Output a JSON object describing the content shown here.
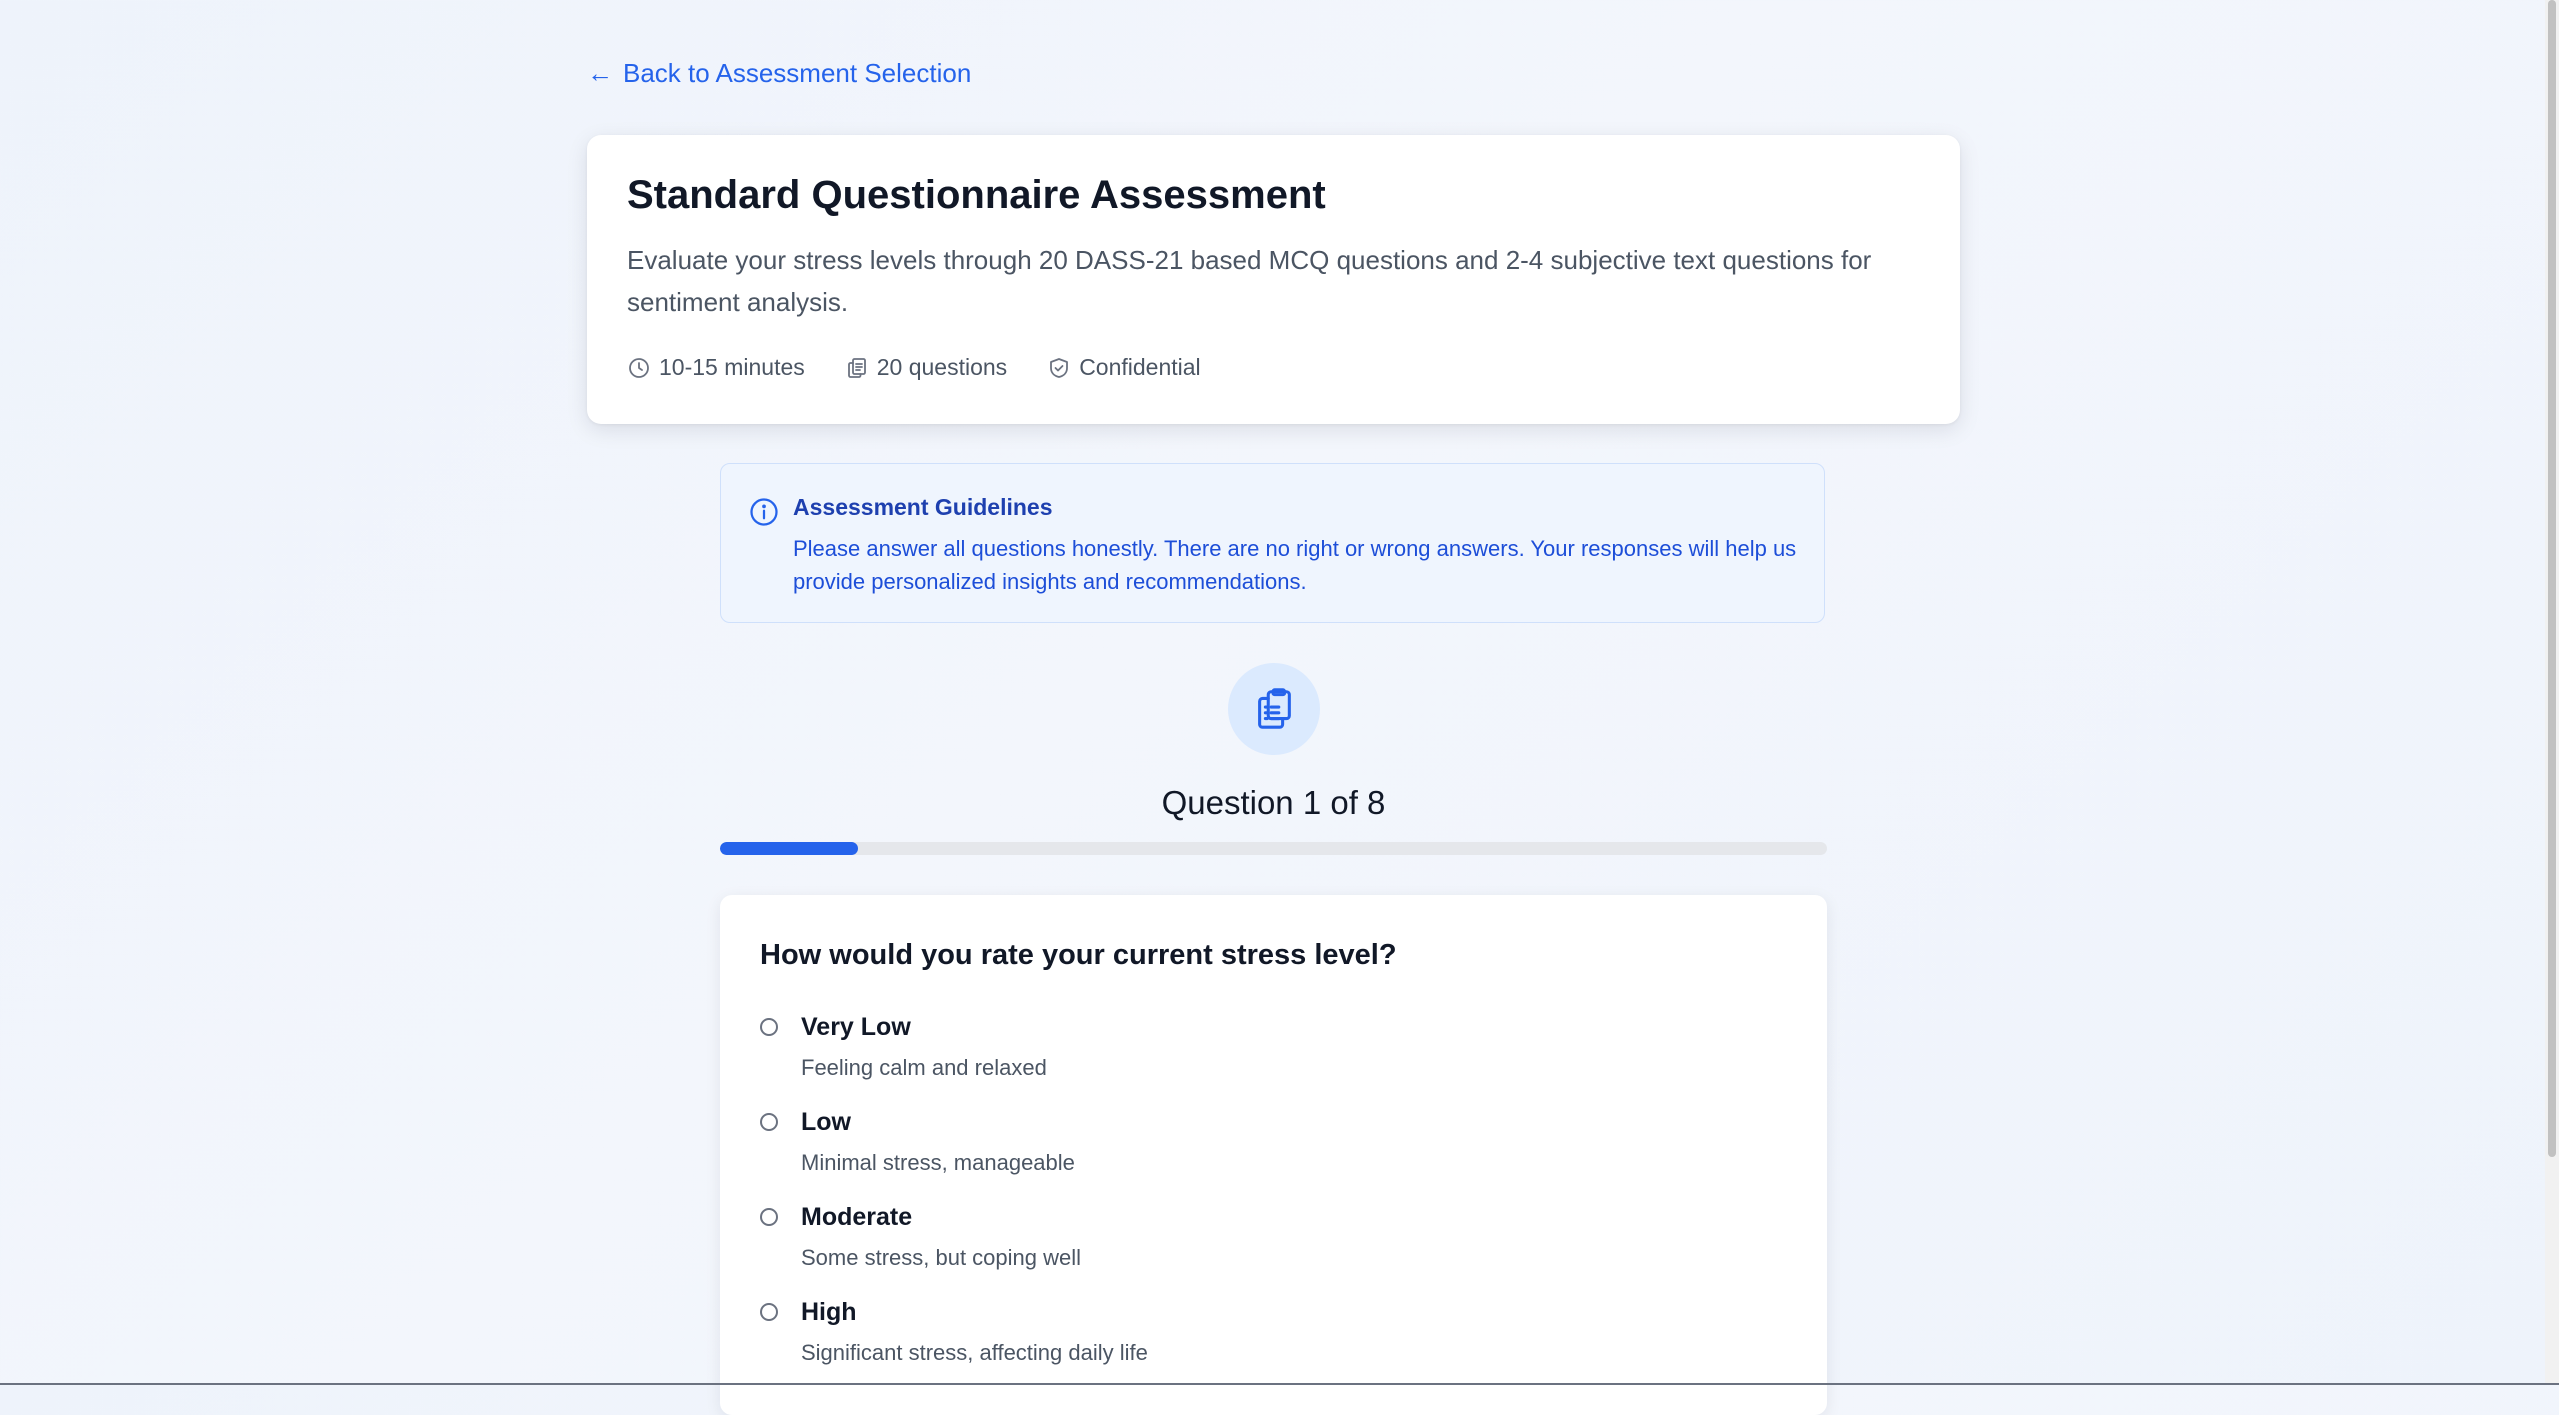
{
  "nav": {
    "back_arrow": "←",
    "back_label": "Back to Assessment Selection"
  },
  "header": {
    "title": "Standard Questionnaire Assessment",
    "description": "Evaluate your stress levels through 20 DASS-21 based MCQ questions and 2-4 subjective text questions for sentiment analysis.",
    "meta": {
      "duration": "10-15 minutes",
      "questions": "20 questions",
      "privacy": "Confidential"
    }
  },
  "guidelines": {
    "title": "Assessment Guidelines",
    "text": "Please answer all questions honestly. There are no right or wrong answers. Your responses will help us provide personalized insights and recommendations."
  },
  "progress": {
    "label": "Question 1 of 8",
    "current": 1,
    "total": 8,
    "fraction": 0.125
  },
  "question": {
    "text": "How would you rate your current stress level?",
    "options": [
      {
        "label": "Very Low",
        "description": "Feeling calm and relaxed"
      },
      {
        "label": "Low",
        "description": "Minimal stress, manageable"
      },
      {
        "label": "Moderate",
        "description": "Some stress, but coping well"
      },
      {
        "label": "High",
        "description": "Significant stress, affecting daily life"
      }
    ]
  },
  "icons": {
    "back": "arrow-left-icon",
    "duration": "clock-icon",
    "questions": "document-copy-icon",
    "privacy": "shield-check-icon",
    "guidelines": "info-circle-icon",
    "questionnaire": "clipboard-list-icon"
  },
  "colors": {
    "accent": "#2563eb",
    "background": "#eef3fb",
    "card": "#ffffff",
    "guideline_bg": "#eff5fe",
    "guideline_text": "#1d4ed8",
    "progress_track": "#e5e7eb"
  }
}
